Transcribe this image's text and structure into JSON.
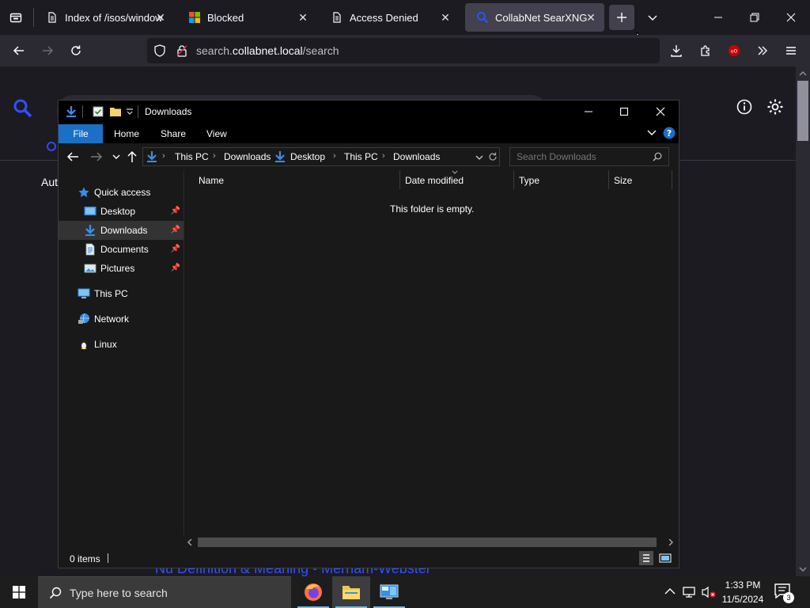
{
  "browser": {
    "tabs": [
      {
        "title": "Index of /isos/windows",
        "icon": "document-icon"
      },
      {
        "title": "Blocked",
        "icon": "windows-logo-icon"
      },
      {
        "title": "Access Denied",
        "icon": "document-icon"
      },
      {
        "title": "CollabNet SearXNG",
        "icon": "searxng-icon",
        "active": true
      }
    ],
    "url_prefix": "search.",
    "url_domain": "collabnet.local",
    "url_path": "/search"
  },
  "webpage": {
    "sidebar_fragment": "Aut",
    "result_fragment": "Nu Definition & Meaning - Merriam-Webster"
  },
  "explorer": {
    "title": "Downloads",
    "ribbon_tabs": [
      "File",
      "Home",
      "Share",
      "View"
    ],
    "breadcrumbs": [
      "This PC",
      "Downloads",
      "Desktop",
      "This PC",
      "Downloads"
    ],
    "search_placeholder": "Search Downloads",
    "columns": [
      "Name",
      "Date modified",
      "Type",
      "Size"
    ],
    "empty_message": "This folder is empty.",
    "status": "0 items",
    "nav": {
      "quick_access": "Quick access",
      "items": [
        {
          "label": "Desktop",
          "pinned": true
        },
        {
          "label": "Downloads",
          "pinned": true,
          "selected": true
        },
        {
          "label": "Documents",
          "pinned": true
        },
        {
          "label": "Pictures",
          "pinned": true
        }
      ],
      "this_pc": "This PC",
      "network": "Network",
      "linux": "Linux"
    }
  },
  "taskbar": {
    "search_placeholder": "Type here to search",
    "time": "1:33 PM",
    "date": "11/5/2024",
    "notification_count": "3"
  },
  "colors": {
    "accent": "#1a6fc6",
    "browser_bg": "#1c1b22",
    "toolbar_bg": "#2b2a33",
    "searxng_blue": "#3050ff"
  }
}
